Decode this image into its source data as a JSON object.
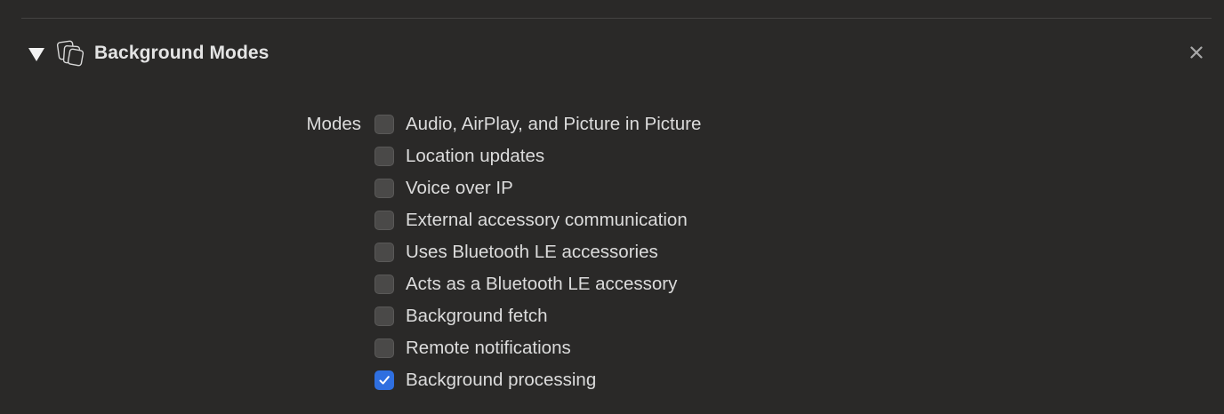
{
  "section": {
    "title": "Background Modes",
    "disclosure_icon": "disclosure-triangle-down",
    "capability_icon": "background-modes-icon",
    "close_icon": "close-icon"
  },
  "modes": {
    "label": "Modes",
    "options": [
      {
        "label": "Audio, AirPlay, and Picture in Picture",
        "checked": false
      },
      {
        "label": "Location updates",
        "checked": false
      },
      {
        "label": "Voice over IP",
        "checked": false
      },
      {
        "label": "External accessory communication",
        "checked": false
      },
      {
        "label": "Uses Bluetooth LE accessories",
        "checked": false
      },
      {
        "label": "Acts as a Bluetooth LE accessory",
        "checked": false
      },
      {
        "label": "Background fetch",
        "checked": false
      },
      {
        "label": "Remote notifications",
        "checked": false
      },
      {
        "label": "Background processing",
        "checked": true
      }
    ]
  },
  "colors": {
    "background": "#2a2928",
    "checkbox_checked": "#2f6fe0",
    "checkbox_unchecked": "#4a4948",
    "text": "#dcdcdc"
  }
}
